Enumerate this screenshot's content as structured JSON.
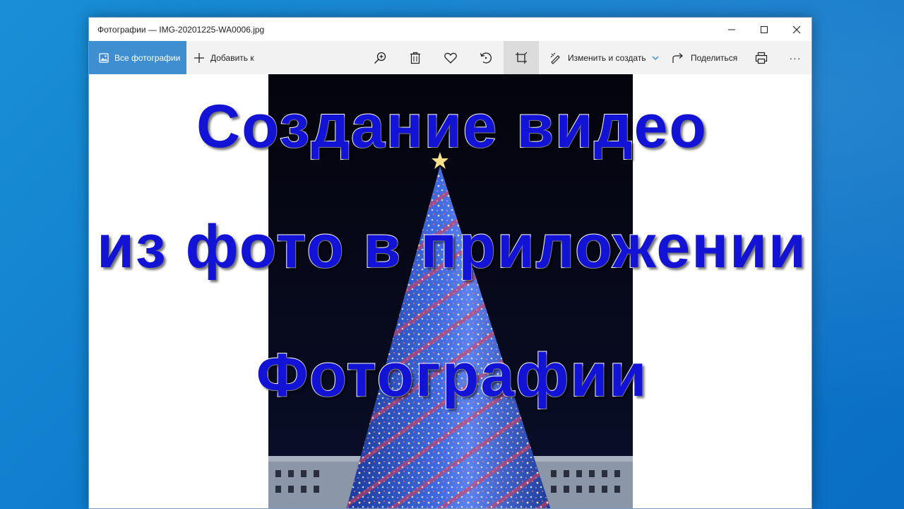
{
  "window": {
    "title": "Фотографии — IMG-20201225-WA0006.jpg"
  },
  "toolbar": {
    "all_photos_label": "Все фотографии",
    "add_to_label": "Добавить к",
    "edit_create_label": "Изменить и создать",
    "share_label": "Поделиться",
    "more_label": "···"
  },
  "icons": [
    "photos-icon",
    "plus-icon",
    "zoom-icon",
    "trash-icon",
    "heart-icon",
    "rotate-icon",
    "crop-icon",
    "edit-icon",
    "chevron-down-icon",
    "share-icon",
    "print-icon",
    "minimize-icon",
    "maximize-icon",
    "close-icon"
  ],
  "overlay": {
    "line1": "Создание видео",
    "line2": "из фото в приложении",
    "line3": "Фотографии"
  },
  "colors": {
    "accent": "#3f8fd0",
    "overlay_text": "#1313d6",
    "desktop": "#0f7ccc"
  }
}
